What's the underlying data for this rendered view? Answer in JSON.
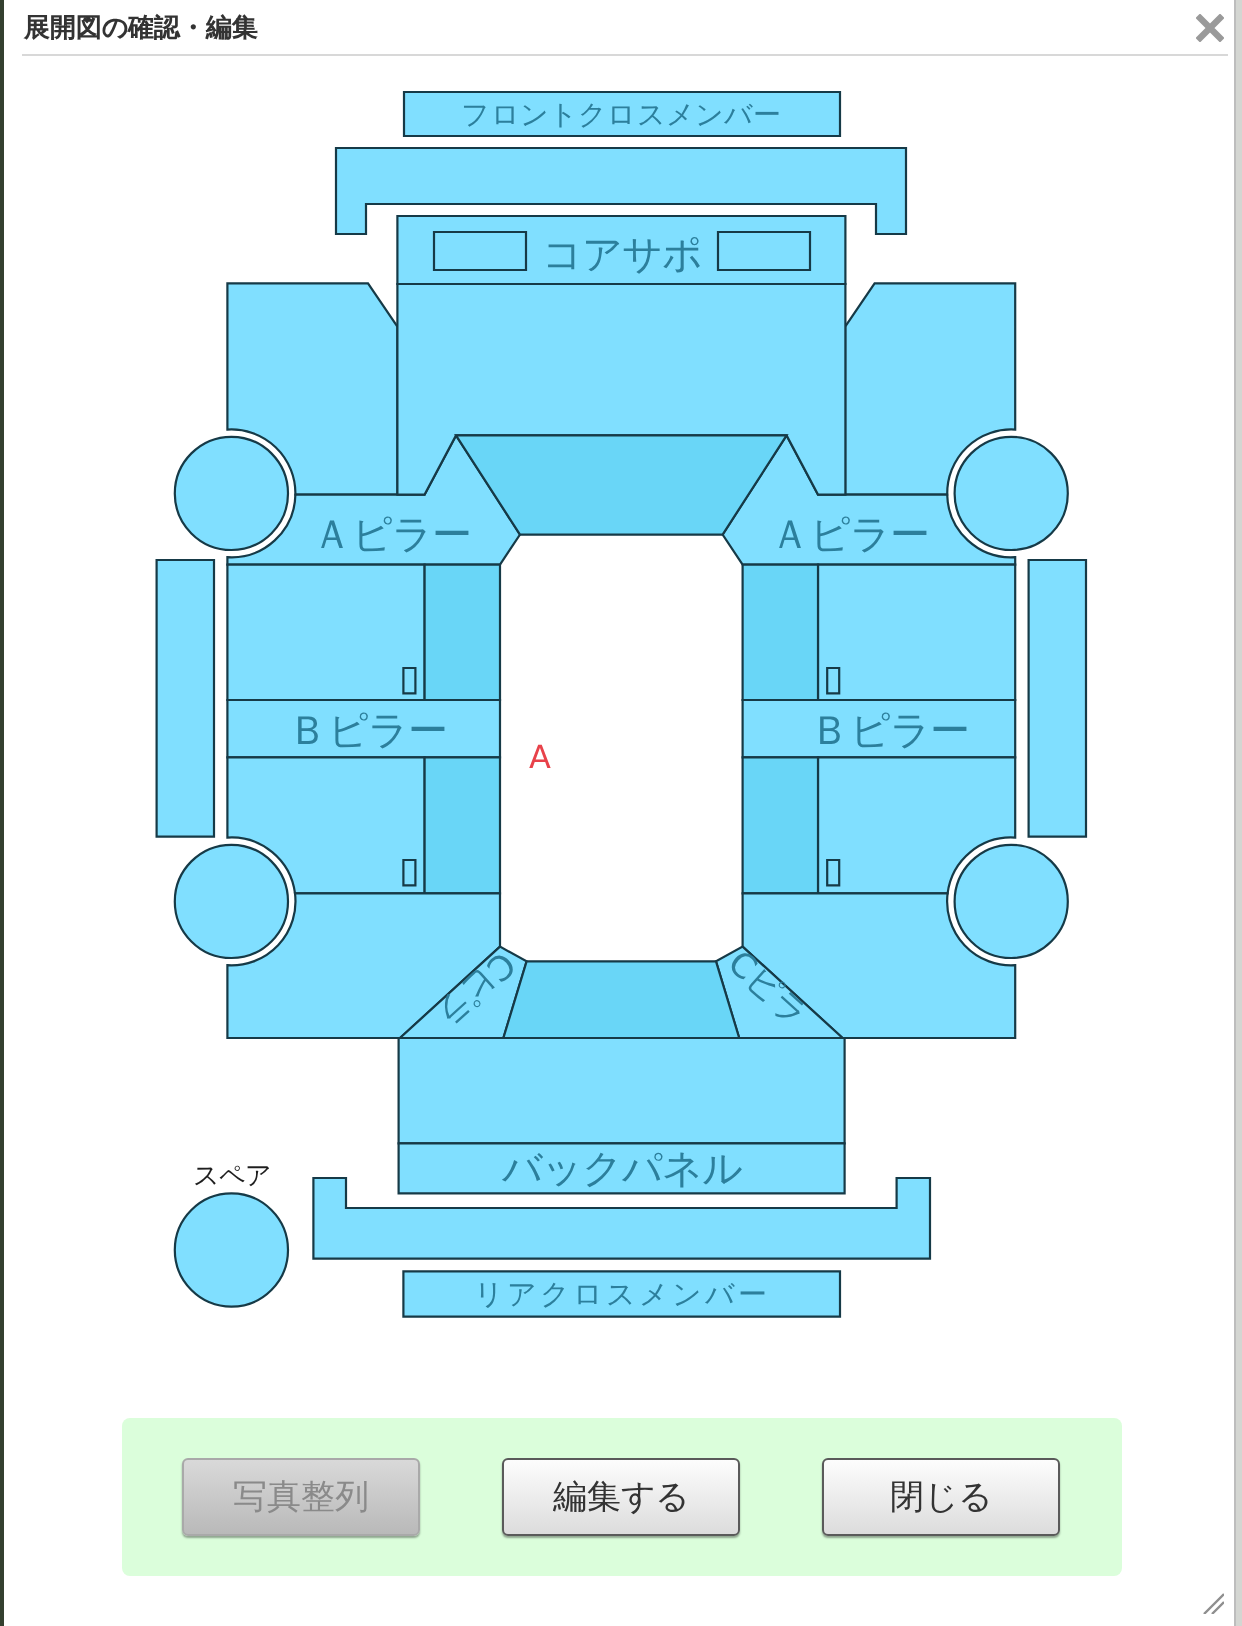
{
  "window": {
    "title": "展開図の確認・編集"
  },
  "diagram": {
    "front_cross_member": "フロントクロスメンバー",
    "core_support": "コアサポ",
    "a_pillar_left": "Ａピラー",
    "a_pillar_right": "Ａピラー",
    "b_pillar_left": "Ｂピラー",
    "b_pillar_right": "Ｂピラー",
    "marker": "A",
    "c_pillar_left": "Cピラ",
    "c_pillar_right": "Cピラ",
    "back_panel": "バックパネル",
    "spare": "スペア",
    "rear_cross_member": "リアクロスメンバー"
  },
  "buttons": [
    {
      "label": "写真整列",
      "disabled": true
    },
    {
      "label": "編集する",
      "disabled": false
    },
    {
      "label": "閉じる",
      "disabled": false
    }
  ]
}
